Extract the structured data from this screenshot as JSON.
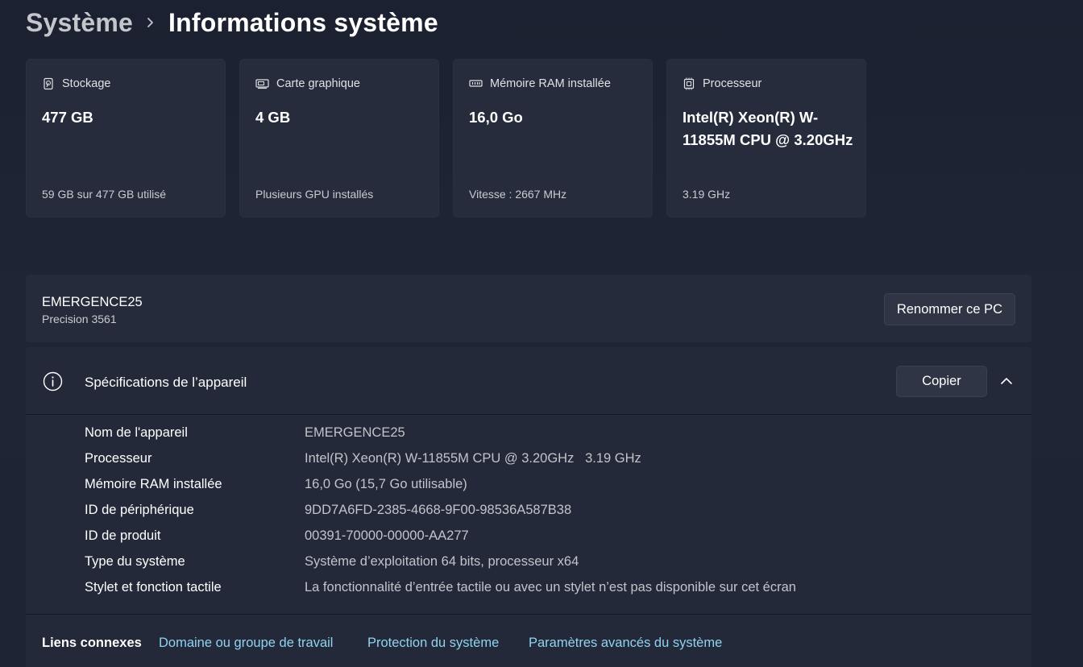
{
  "breadcrumb": {
    "parent": "Système",
    "current": "Informations système"
  },
  "cards": [
    {
      "icon": "storage-icon",
      "title": "Stockage",
      "value": "477 GB",
      "sub": "59 GB sur 477 GB utilisé"
    },
    {
      "icon": "graphics-card-icon",
      "title": "Carte graphique",
      "value": "4 GB",
      "sub": "Plusieurs GPU installés"
    },
    {
      "icon": "memory-icon",
      "title": "Mémoire RAM installée",
      "value": "16,0 Go",
      "sub": "Vitesse : 2667 MHz"
    },
    {
      "icon": "processor-icon",
      "title": "Processeur",
      "value": "Intel(R) Xeon(R) W-11855M CPU @ 3.20GHz",
      "sub": "3.19 GHz"
    }
  ],
  "device": {
    "name": "EMERGENCE25",
    "model": "Precision 3561",
    "rename_label": "Renommer ce PC"
  },
  "specs": {
    "title": "Spécifications de l’appareil",
    "copy_label": "Copier",
    "rows": [
      {
        "label": "Nom de l'appareil",
        "value": "EMERGENCE25"
      },
      {
        "label": "Processeur",
        "value": "Intel(R) Xeon(R) W-11855M CPU @ 3.20GHz   3.19 GHz"
      },
      {
        "label": "Mémoire RAM installée",
        "value": "16,0 Go (15,7 Go utilisable)"
      },
      {
        "label": "ID de périphérique",
        "value": "9DD7A6FD-2385-4668-9F00-98536A587B38"
      },
      {
        "label": "ID de produit",
        "value": "00391-70000-00000-AA277"
      },
      {
        "label": "Type du système",
        "value": "Système d’exploitation 64 bits, processeur x64"
      },
      {
        "label": "Stylet et fonction tactile",
        "value": "La fonctionnalité d’entrée tactile ou avec un stylet n’est pas disponible sur cet écran"
      }
    ]
  },
  "related": {
    "title": "Liens connexes",
    "links": [
      "Domaine ou groupe de travail",
      "Protection du système",
      "Paramètres avancés du système"
    ]
  },
  "colors": {
    "background": "#1d2331",
    "card": "#262c3b",
    "link": "#8fd3f2"
  }
}
